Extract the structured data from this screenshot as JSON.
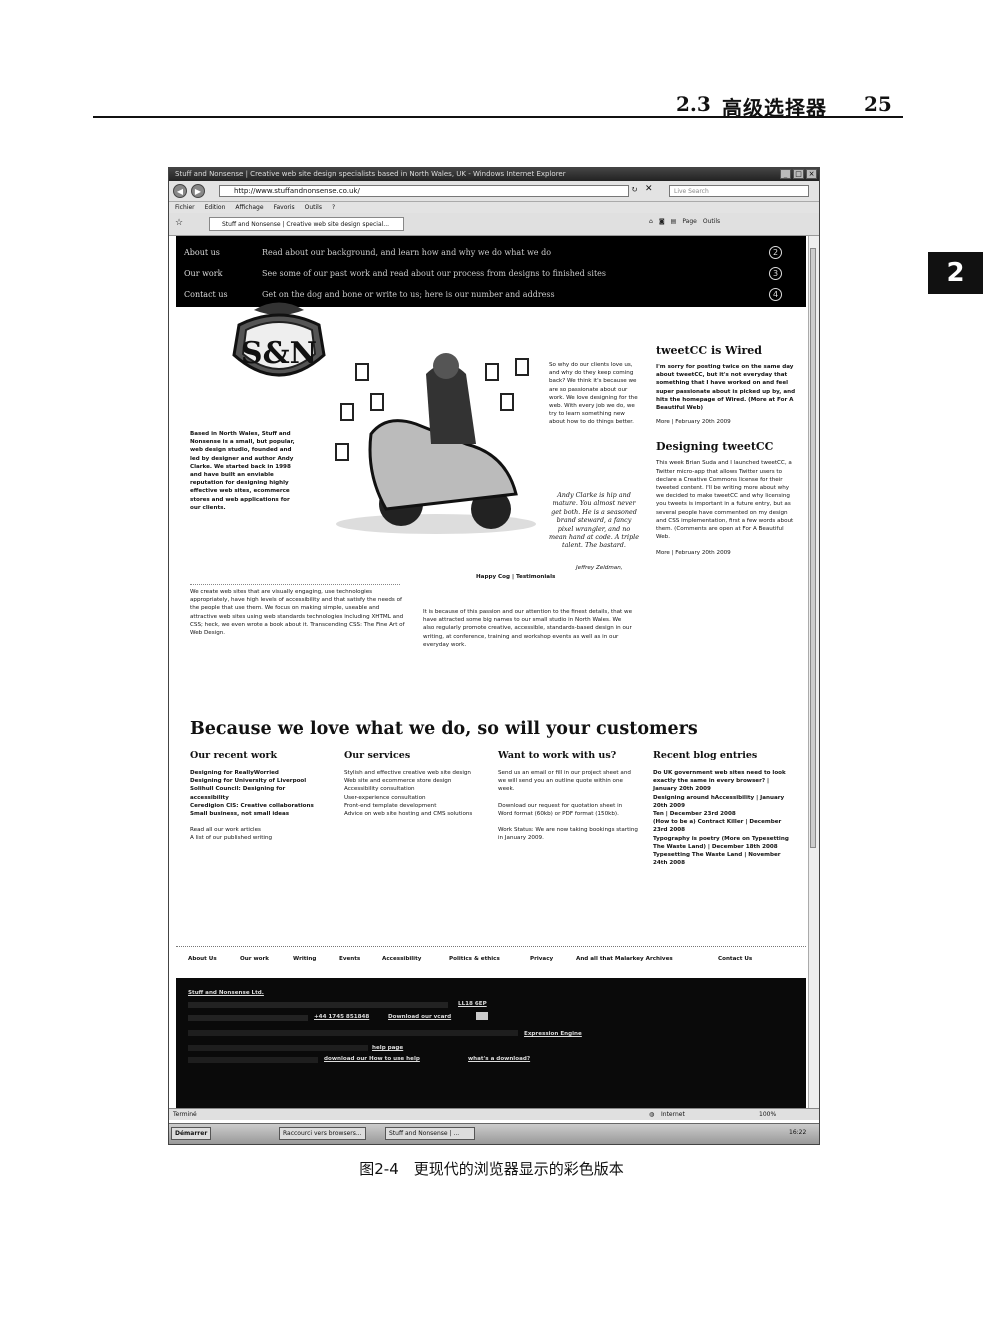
{
  "book": {
    "section_number": "2.3",
    "section_title": "高级选择器",
    "page_number": "25",
    "chapter_tab": "2",
    "caption": "图2-4　更现代的浏览器显示的彩色版本"
  },
  "browser": {
    "window_title": "Stuff and Nonsense | Creative web site design specialists based in North Wales, UK - Windows Internet Explorer",
    "url": "http://www.stuffandnonsense.co.uk/",
    "search_placeholder": "Live Search",
    "menu": [
      "Fichier",
      "Edition",
      "Affichage",
      "Favoris",
      "Outils",
      "?"
    ],
    "tab_label": "Stuff and Nonsense | Creative web site design special...",
    "tools": [
      "Page",
      "Outils"
    ],
    "status_left": "Terminé",
    "status_zone": "Internet",
    "zoom": "100%",
    "taskbar": {
      "start": "Démarrer",
      "items": [
        "Raccourci vers browsers...",
        "Stuff and Nonsense | ..."
      ],
      "clock": "16:22"
    }
  },
  "site": {
    "nav": [
      {
        "label": "About us",
        "desc": "Read about our background, and learn how and why we do what we do",
        "num": "2"
      },
      {
        "label": "Our work",
        "desc": "See some of our past work and read about our process from designs to finished sites",
        "num": "3"
      },
      {
        "label": "Contact us",
        "desc": "Get on the dog and bone or write to us; here is our number and address",
        "num": "4"
      }
    ],
    "logo_text": "S&N",
    "intro_bold": "Based in North Wales, Stuff and Nonsense is a small, but popular, web design studio, founded and led by designer and author Andy Clarke. We started back in 1998 and have built an enviable reputation for designing highly effective web sites, ecommerce stores and web applications for our clients.",
    "mid_text": "So why do our clients love us, and why do they keep coming back? We think it's because we are so passionate about our work. We love designing for the web. With every job we do, we try to learn something new about how to do things better.",
    "quote": "Andy Clarke is hip and mature. You almost never get both. He is a seasoned brand steward, a fancy pixel wrangler, and no mean hand at code. A triple talent. The bastard.",
    "quote_author": "Jeffrey Zeldman,",
    "quote_source": "Happy Cog | Testimonials",
    "para_left": "We create web sites that are visually engaging, use technologies appropriately, have high levels of accessibility and that satisfy the needs of the people that use them. We focus on making simple, useable and attractive web sites using web standards technologies including XHTML and CSS; heck, we even wrote a book about it. Transcending CSS: The Fine Art of Web Design.",
    "para_mid": "It is because of this passion and our attention to the finest details, that we have attracted some big names to our small studio in North Wales. We also regularly promote creative, accessible, standards-based design in our writing, at conference, training and workshop events as well as in our everyday work.",
    "sidebar": {
      "post1_title": "tweetCC is Wired",
      "post1_body": "I'm sorry for posting twice on the same day about tweetCC, but it's not everyday that something that I have worked on and feel super passionate about is picked up by, and hits the homepage of Wired. (More at For A Beautiful Web)",
      "post1_meta": "More | February 20th 2009",
      "post2_title": "Designing tweetCC",
      "post2_body": "This week Brian Suda and I launched tweetCC, a Twitter micro-app that allows Twitter users to declare a Creative Commons license for their tweeted content. I'll be writing more about why we decided to make tweetCC and why licensing you tweets is important in a future entry, but as several people have commented on my design and CSS implementation, first a few words about them. (Comments are open at For A Beautiful Web.",
      "post2_meta": "More | February 20th 2009"
    },
    "big_heading": "Because we love what we do, so will your customers",
    "columns": {
      "recent_work_title": "Our recent work",
      "recent_work": [
        "Designing for ReallyWorried",
        "Designing for University of Liverpool",
        "Solihull Council: Designing for accessibility",
        "Ceredigion CIS: Creative collaborations",
        "Small business, not small ideas"
      ],
      "recent_work_more1": "Read all our work articles",
      "recent_work_more2": "A list of our published writing",
      "services_title": "Our services",
      "services": [
        "Stylish and effective creative web site design",
        "Web site and ecommerce store design",
        "Accessibility consultation",
        "User-experience consultation",
        "Front-end template development",
        "Advice on web site hosting and CMS solutions"
      ],
      "work_title": "Want to work with us?",
      "work_p1": "Send us an email or fill in our project sheet and we will send you an outline quote within one week.",
      "work_p2": "Download our request for quotation sheet in Word format (60kb) or PDF format (150kb).",
      "work_p3": "Work Status: We are now taking bookings starting in January 2009.",
      "blog_title": "Recent blog entries",
      "blog": [
        "Do UK government web sites need to look exactly the same in every browser? | January 20th 2009",
        "Designing around hAccessibility | January 20th 2009",
        "Ten | December 23rd 2008",
        "(How to be a) Contract Killer | December 23rd 2008",
        "Typography is poetry (More on Typesetting The Waste Land) | December 18th 2008",
        "Typesetting The Waste Land | November 24th 2008"
      ]
    },
    "footer_nav": [
      "About Us",
      "Our work",
      "Writing",
      "Events",
      "Accessibility",
      "Politics & ethics",
      "Privacy",
      "And all that Malarkey Archives",
      "Contact Us"
    ],
    "footer": {
      "company": "Stuff and Nonsense Ltd.",
      "postcode": "LL18 6EP",
      "phone": "+44 1745 851848",
      "vcard": "Download our vcard",
      "engine": "Expression Engine",
      "help": "help page",
      "howto": "download our How to use help",
      "download": "what's a download?"
    }
  }
}
